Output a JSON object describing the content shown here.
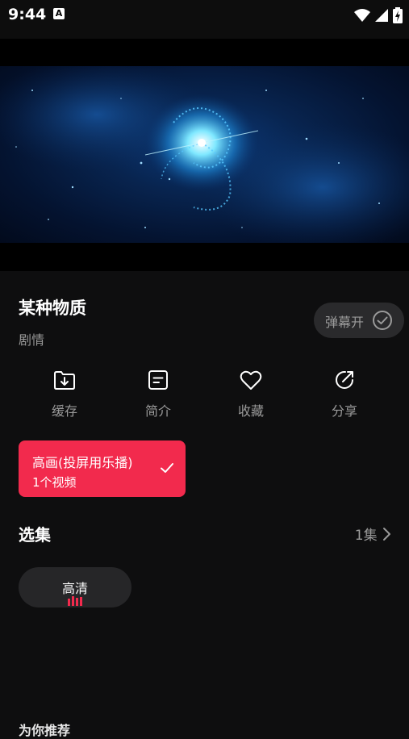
{
  "status_bar": {
    "time": "9:44",
    "notification_glyph": "A"
  },
  "video": {
    "description_icon": "galaxy-artwork"
  },
  "detail": {
    "title": "某种物质",
    "genre": "剧情",
    "danmu_label": "弹幕开"
  },
  "actions": [
    {
      "label": "缓存",
      "icon": "download-folder-icon"
    },
    {
      "label": "简介",
      "icon": "document-icon"
    },
    {
      "label": "收藏",
      "icon": "heart-icon"
    },
    {
      "label": "分享",
      "icon": "share-icon"
    }
  ],
  "source": {
    "title": "高画(投屏用乐播)",
    "subtitle": "1个视频",
    "accent": "#f22a4d"
  },
  "episodes": {
    "title": "选集",
    "count": "1集",
    "items": [
      {
        "label": "高清"
      }
    ]
  },
  "bottom_cutoff_text": "为你推荐"
}
